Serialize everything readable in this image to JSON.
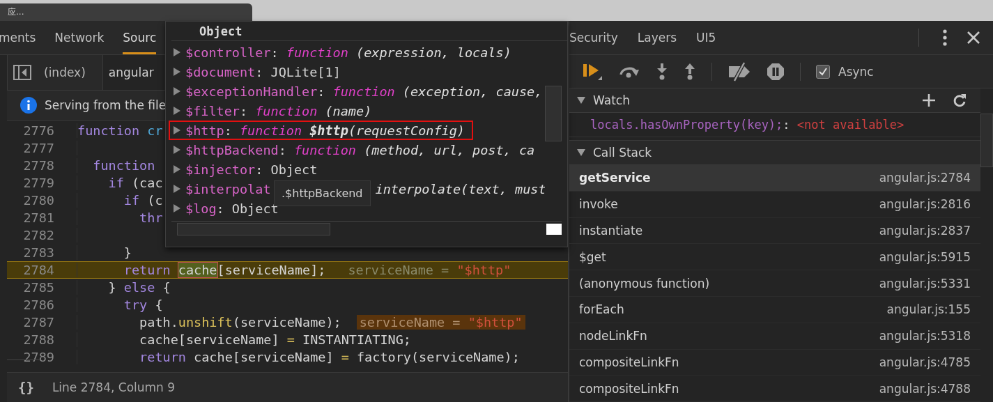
{
  "browser_tab": {
    "title": "应..."
  },
  "left_tabs": [
    {
      "label": "ments",
      "selected": false
    },
    {
      "label": "Network",
      "selected": false
    },
    {
      "label": "Sourc",
      "selected": true
    }
  ],
  "file_tabs": [
    {
      "label": "(index)",
      "selected": false
    },
    {
      "label": "angular",
      "selected": true
    }
  ],
  "info_bar": {
    "text": "Serving from the file"
  },
  "code_lines": [
    {
      "number": "2776",
      "current": false,
      "segments": [
        {
          "kind": "kw",
          "text": "function"
        },
        {
          "kind": "name",
          "text": " cr"
        }
      ]
    },
    {
      "number": "2777",
      "current": false
    },
    {
      "number": "2778",
      "current": false,
      "segments": [
        {
          "kind": "kw",
          "text": "  function"
        }
      ]
    },
    {
      "number": "2779",
      "current": false,
      "segments": [
        {
          "kind": "kw",
          "text": "    if"
        },
        {
          "kind": "plain",
          "text": " (cac"
        }
      ]
    },
    {
      "number": "2780",
      "current": false,
      "segments": [
        {
          "kind": "kw",
          "text": "      if"
        },
        {
          "kind": "plain",
          "text": " (c"
        }
      ]
    },
    {
      "number": "2781",
      "current": false,
      "segments": [
        {
          "kind": "kw",
          "text": "        thr"
        }
      ]
    },
    {
      "number": "2782",
      "current": false
    },
    {
      "number": "2783",
      "current": false,
      "segments": [
        {
          "kind": "plain",
          "text": "      }"
        }
      ]
    },
    {
      "number": "2784",
      "current": true,
      "segments": [
        {
          "kind": "kw",
          "text": "      return "
        },
        {
          "kind": "focus",
          "text": "cache"
        },
        {
          "kind": "plain",
          "text": "[serviceName];"
        }
      ],
      "inline_value": {
        "name": "serviceName",
        "operator": "=",
        "value": "\"$http\""
      }
    },
    {
      "number": "2785",
      "current": false,
      "segments": [
        {
          "kind": "plain",
          "text": "    } "
        },
        {
          "kind": "kw",
          "text": "else"
        },
        {
          "kind": "plain",
          "text": " {"
        }
      ]
    },
    {
      "number": "2786",
      "current": false,
      "segments": [
        {
          "kind": "kw",
          "text": "      try"
        },
        {
          "kind": "plain",
          "text": " {"
        }
      ]
    },
    {
      "number": "2787",
      "current": false,
      "segments": [
        {
          "kind": "plain",
          "text": "        path."
        },
        {
          "kind": "call",
          "text": "unshift"
        },
        {
          "kind": "plain",
          "text": "(serviceName);"
        }
      ],
      "inline_value": {
        "name": "serviceName",
        "operator": "=",
        "value": "\"$http\""
      }
    },
    {
      "number": "2788",
      "current": false,
      "segments": [
        {
          "kind": "plain",
          "text": "        cache[serviceName] "
        },
        {
          "kind": "op",
          "text": "="
        },
        {
          "kind": "plain",
          "text": " INSTANTIATING;"
        }
      ]
    },
    {
      "number": "2789",
      "current": false,
      "segments": [
        {
          "kind": "kw",
          "text": "        return"
        },
        {
          "kind": "plain",
          "text": " cache[serviceName] "
        },
        {
          "kind": "op",
          "text": "="
        },
        {
          "kind": "plain",
          "text": " factory(serviceName);"
        }
      ]
    }
  ],
  "status_bar": {
    "format_button": "{}",
    "position": "Line 2784, Column 9"
  },
  "popover": {
    "title": "Object",
    "tooltip": ".$httpBackend",
    "separator": ":",
    "properties": [
      {
        "name": "$controller",
        "kind": "function",
        "signature": "(expression, locals)",
        "highlighted": false
      },
      {
        "name": "$document",
        "kind": "object",
        "value": "JQLite[1]",
        "highlighted": false
      },
      {
        "name": "$exceptionHandler",
        "kind": "function",
        "signature": "(exception, cause,",
        "highlighted": false
      },
      {
        "name": "$filter",
        "kind": "function",
        "signature": "(name)",
        "highlighted": false
      },
      {
        "name": "$http",
        "kind": "function",
        "fn_name": "$http",
        "signature": "(requestConfig)",
        "highlighted": true
      },
      {
        "name": "$httpBackend",
        "kind": "function",
        "signature": "(method, url, post, ca",
        "highlighted": false
      },
      {
        "name": "$injector",
        "kind": "object",
        "value": "Object",
        "highlighted": false
      },
      {
        "name": "$interpolat",
        "kind": "covered",
        "signature": "interpolate(text, must",
        "highlighted": false
      },
      {
        "name": "$log",
        "kind": "object",
        "value": "Object",
        "highlighted": false
      }
    ]
  },
  "right_tabs": [
    {
      "label": "Security",
      "selected": false
    },
    {
      "label": "Layers",
      "selected": false
    },
    {
      "label": "UI5",
      "selected": false
    }
  ],
  "async": {
    "label": "Async",
    "checked": true
  },
  "watch": {
    "title": "Watch",
    "expanded": true,
    "expressions": [
      {
        "expression": "locals.hasOwnProperty(key);",
        "separator": ":",
        "value": "<not available>"
      }
    ]
  },
  "call_stack": {
    "title": "Call Stack",
    "expanded": true,
    "frames": [
      {
        "name": "getService",
        "location": "angular.js:2784",
        "selected": true
      },
      {
        "name": "invoke",
        "location": "angular.js:2816",
        "selected": false
      },
      {
        "name": "instantiate",
        "location": "angular.js:2837",
        "selected": false
      },
      {
        "name": "$get",
        "location": "angular.js:5915",
        "selected": false
      },
      {
        "name": "(anonymous function)",
        "location": "angular.js:5331",
        "selected": false
      },
      {
        "name": "forEach",
        "location": "angular.js:155",
        "selected": false
      },
      {
        "name": "nodeLinkFn",
        "location": "angular.js:5318",
        "selected": false
      },
      {
        "name": "compositeLinkFn",
        "location": "angular.js:4785",
        "selected": false
      },
      {
        "name": "compositeLinkFn",
        "location": "angular.js:4788",
        "selected": false
      }
    ]
  }
}
